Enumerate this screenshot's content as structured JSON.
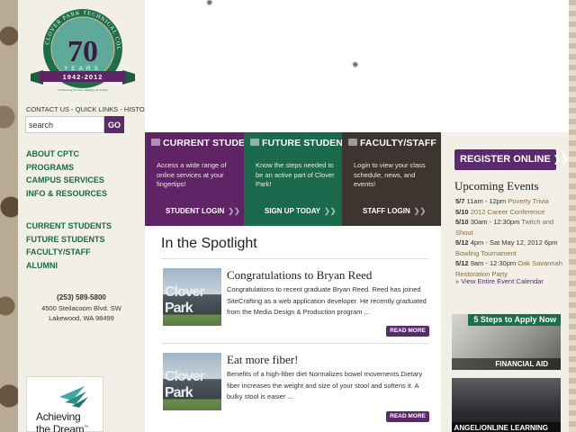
{
  "logo": {
    "arc_text": "CLOVER PARK TECHNICAL COLLEGE",
    "number": "70",
    "years": "YEARS",
    "dates": "1942-2012",
    "tagline": "Celebrating the Past, Shaping the Future"
  },
  "top_links": [
    "CONTACT US",
    "QUICK LINKS",
    "HISTORY"
  ],
  "search": {
    "value": "search",
    "button": "GO"
  },
  "nav_primary": [
    "ABOUT CPTC",
    "PROGRAMS",
    "CAMPUS SERVICES",
    "INFO & RESOURCES"
  ],
  "nav_audience": [
    "CURRENT STUDENTS",
    "FUTURE STUDENTS",
    "FACULTY/STAFF",
    "ALUMNI"
  ],
  "contact": {
    "phone": "(253) 589-5800",
    "address1": "4500 Steilacoom Blvd. SW",
    "address2": "Lakewood, WA 98499"
  },
  "achieving": {
    "line1": "Achieving",
    "line2": "the Dream",
    "tm": "™"
  },
  "panels": [
    {
      "title": "CURRENT STUDENTS",
      "text": "Access a wide range of online services at your fingertips!",
      "button": "STUDENT LOGIN",
      "color": "#5e2466"
    },
    {
      "title": "FUTURE STUDENTS",
      "text": "Know the steps needed to be an active part of Clover Park!",
      "button": "SIGN UP TODAY",
      "color": "#1c6a4e"
    },
    {
      "title": "FACULTY/STAFF",
      "text": "Login to view your class schedule, news, and events!",
      "button": "STAFF LOGIN",
      "color": "#3e3530"
    }
  ],
  "spotlight": {
    "title": "In the Spotlight",
    "stories": [
      {
        "thumb_text": "Clover Park",
        "title": "Congratulations to Bryan Reed",
        "body": "Congratulations to recent graduate Bryan Reed. Reed has joined SiteCrafting as a web application developer. He recently graduated from the Media Design & Production program ...",
        "button": "READ MORE"
      },
      {
        "thumb_text": "Clover Park",
        "title": "Eat more fiber!",
        "body": "Benefits of a high-fiber diet     Normalizes bowel movements.Dietary fiber increases the weight and size of your stool and softens it. A bulky stool is easier ...",
        "button": "READ MORE"
      }
    ]
  },
  "register": {
    "label": "REGISTER ONLINE"
  },
  "events": {
    "title": "Upcoming Events",
    "items": [
      {
        "date": "5/7",
        "time": "11am - 12pm",
        "name": "Poverty Trivia"
      },
      {
        "date": "5/10",
        "time": "2012 Career Conference",
        "name": ""
      },
      {
        "date": "5/10",
        "time": "30am - 12:30pm",
        "name": "Twitch and Shout"
      },
      {
        "date": "5/12",
        "time": "4pm - Sat May 12, 2012 6pm",
        "name": "Bowling Tournament"
      },
      {
        "date": "5/12",
        "time": "9am - 12:30pm",
        "name": "Oak Savannah Restoration Party"
      }
    ],
    "view_all": "» View Entire Event Calendar"
  },
  "promos": [
    {
      "headline": "5 Steps to Apply Now",
      "label": "FINANCIAL AID"
    },
    {
      "headline": "",
      "label": "ANGEL/ONLINE LEARNING"
    }
  ]
}
